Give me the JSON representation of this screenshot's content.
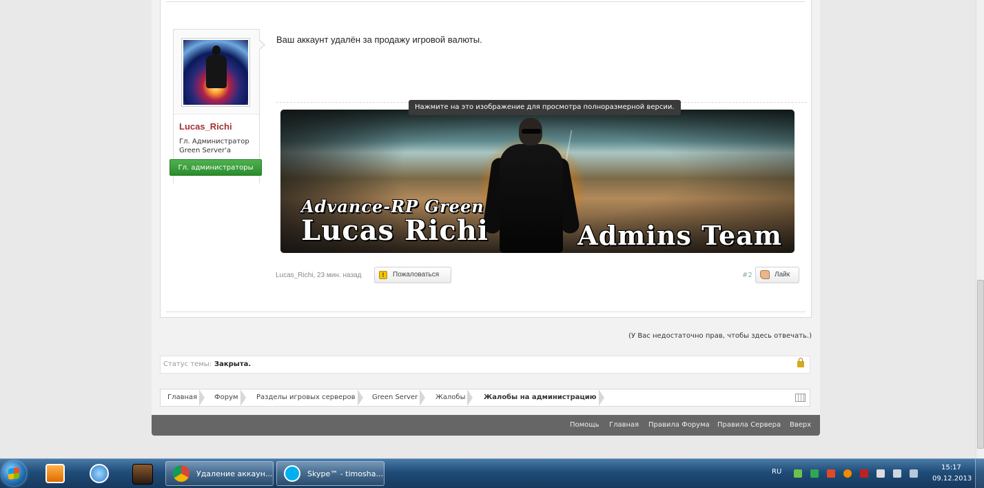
{
  "post": {
    "username": "Lucas_Richi",
    "user_title": "Гл. Администратор Green Server'a",
    "user_group": "Гл. администраторы",
    "message": "Ваш аккаунт удалён за продажу игровой валюты.",
    "image_tooltip": "Нажмите на это изображение для просмотра полноразмерной версии.",
    "signature": {
      "line1": "Advance-RP Green",
      "line2": "Lucas Richi",
      "line3": "Admins Team"
    },
    "meta": "Lucas_Richi, 23 мин. назад",
    "report_label": "Пожаловаться",
    "post_number": "#2",
    "like_label": "Лайк"
  },
  "thread": {
    "no_rights_notice": "(У Вас недостаточно прав, чтобы здесь отвечать.)",
    "status_label": "Статус темы:",
    "status_value": "Закрыта."
  },
  "breadcrumb": [
    "Главная",
    "Форум",
    "Разделы игровых серверов",
    "Green Server",
    "Жалобы",
    "Жалобы на администрацию"
  ],
  "footer_links": [
    "Помощь",
    "Главная",
    "Правила Форума",
    "Правила Сервера",
    "Вверх"
  ],
  "taskbar": {
    "windows": [
      {
        "label": "Удаление аккаун...",
        "icon": "chrome-icon"
      },
      {
        "label": "Skype™ - timosha...",
        "icon": "skype-icon"
      }
    ],
    "pinned": [
      "media-player-icon",
      "download-icon",
      "game-icon"
    ],
    "language": "RU",
    "time": "15:17",
    "date": "09.12.2013"
  },
  "colors": {
    "username": "#a33232",
    "group_badge": "#2a8c2a",
    "footer": "#666666",
    "taskbar": "#1f4c78"
  }
}
